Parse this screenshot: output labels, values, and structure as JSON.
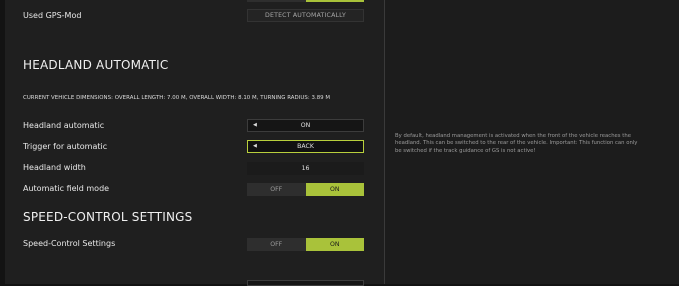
{
  "gps": {
    "label": "Used GPS-Mod",
    "detect_label": "DETECT AUTOMATICALLY"
  },
  "headland": {
    "title": "HEADLAND AUTOMATIC",
    "dimensions": "CURRENT VEHICLE DIMENSIONS: OVERALL LENGTH: 7.00 M, OVERALL WIDTH: 8.10 M, TURNING RADIUS: 3.89 M",
    "rows": {
      "automatic": {
        "label": "Headland automatic",
        "value": "ON"
      },
      "trigger": {
        "label": "Trigger for automatic",
        "value": "BACK"
      },
      "width": {
        "label": "Headland width",
        "value": "16"
      },
      "field_mode": {
        "label": "Automatic field mode",
        "off": "OFF",
        "on": "ON",
        "selected": "ON"
      }
    },
    "description": "By default, headland management is activated when the front of the vehicle reaches the headland. This can be switched to the rear of the vehicle. Important: This function can only be switched if the track guidance of GS is not active!"
  },
  "speed_control": {
    "title": "SPEED-CONTROL SETTINGS",
    "label": "Speed-Control Settings",
    "off": "OFF",
    "on": "ON",
    "selected": "ON"
  },
  "colors": {
    "accent": "#a9c23a",
    "active_border": "#b8cf3c",
    "panel": "#1f1f1f",
    "background": "#131313"
  },
  "icons": {
    "selector_arrow": "left-arrow-icon"
  }
}
